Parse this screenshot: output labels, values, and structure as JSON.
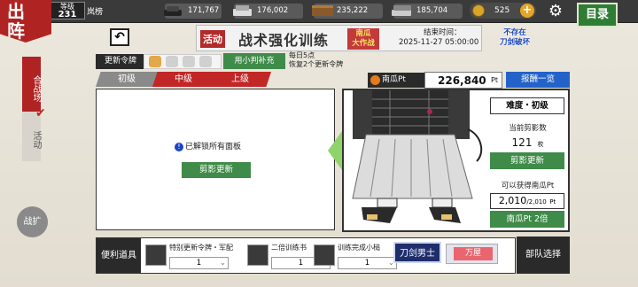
{
  "header": {
    "logo": "出\n阵",
    "level_label": "等级",
    "level": "231",
    "player": "岚榜",
    "resources": [
      {
        "icon": "charcoal-icon",
        "value": "171,767"
      },
      {
        "icon": "steel-icon",
        "value": "176,002"
      },
      {
        "icon": "coolant-icon",
        "value": "235,222"
      },
      {
        "icon": "whetstone-icon",
        "value": "185,704"
      }
    ],
    "coins": "525",
    "menu_label": "目录"
  },
  "side": {
    "tab1": "合战场",
    "tab2": "活动",
    "extend": "战扩"
  },
  "banner": {
    "act": "活动",
    "title": "战术强化训练",
    "event": "南瓜\n大作战",
    "end_label": "结束时间：",
    "end_time": "2025-11-27 05:00:00"
  },
  "notice": "不存在\n刀剑破坏",
  "token": {
    "label": "更新令牌",
    "use_button": "用小判补充",
    "regen_line1": "每日5点",
    "regen_line2": "恢复2个更新令牌"
  },
  "difficulty_tabs": [
    "初级",
    "中级",
    "上级"
  ],
  "left_panel": {
    "info": "已解锁所有面板",
    "button": "剪影更新"
  },
  "pumpkin": {
    "label": "南瓜Pt",
    "value": "226,840",
    "unit": "Pt",
    "reward_button": "报酬一览"
  },
  "right_panel": {
    "difficulty": "难度・初级",
    "count_label": "当前剪影数",
    "count": "121",
    "count_unit": "枚",
    "update_button": "剪影更新",
    "gain_label": "可以获得南瓜Pt",
    "gain": "2,010",
    "gain_max": "/2,010",
    "gain_unit": "Pt",
    "double_button": "南瓜Pt 2倍"
  },
  "bottom": {
    "items_label": "便利道具",
    "items": [
      {
        "name": "特别更新令牌・军配",
        "qty": "1",
        "icon": "fan-icon"
      },
      {
        "name": "二倍训练书",
        "qty": "1",
        "icon": "book-icon"
      },
      {
        "name": "训练完成小槌",
        "qty": "1",
        "icon": "mallet-icon"
      }
    ],
    "unit_a": "刀剑男士",
    "unit_b": "万屋",
    "team_button": "部队选择"
  }
}
